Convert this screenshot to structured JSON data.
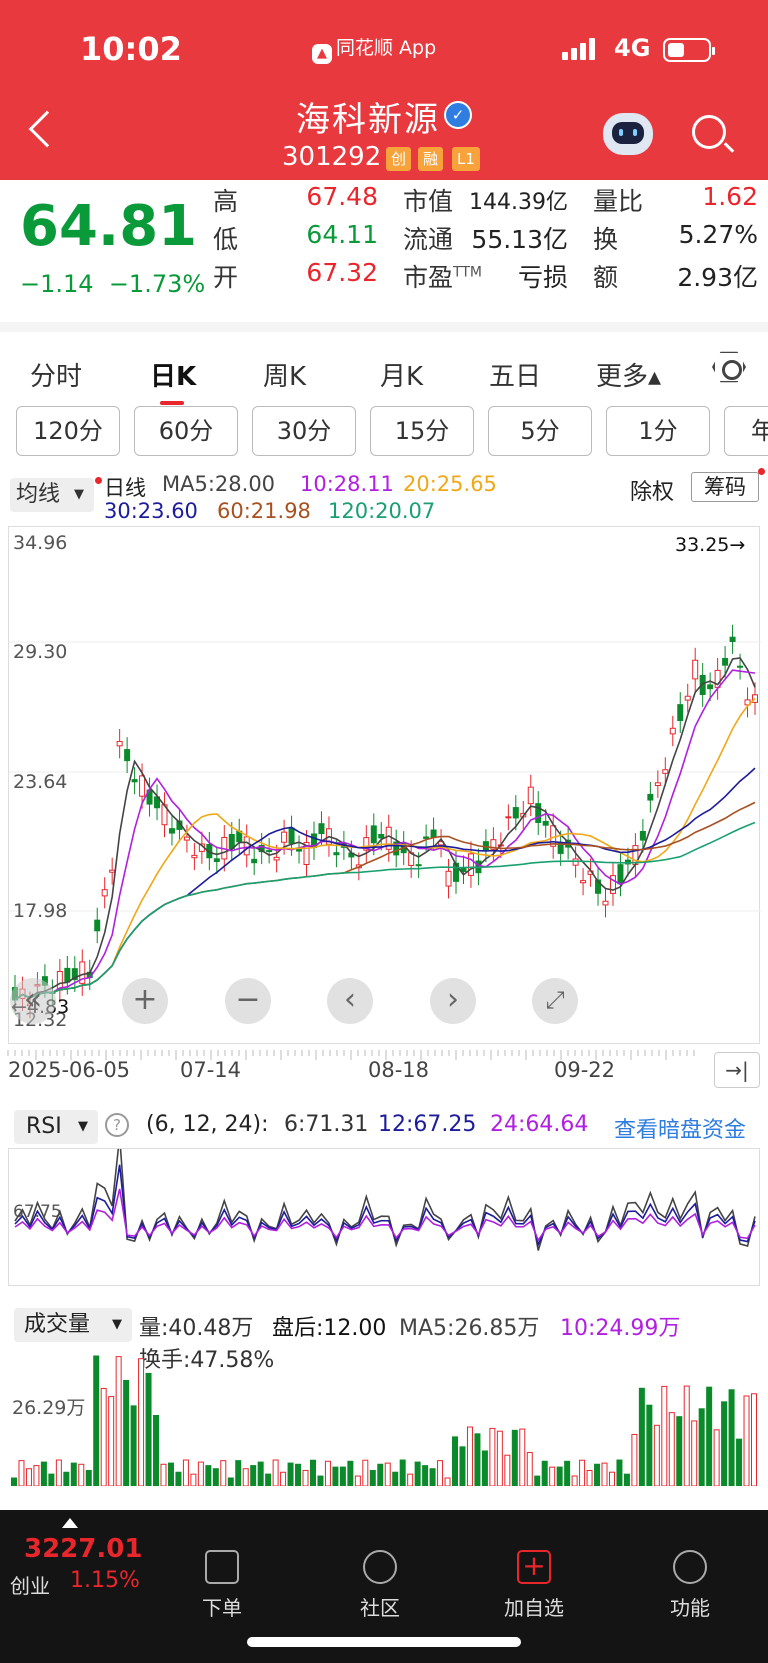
{
  "status_bar": {
    "time": "10:02",
    "app_name": "同花顺 App",
    "network": "4G"
  },
  "header": {
    "stock_name": "海科新源",
    "stock_code": "301292",
    "tags": [
      "创",
      "融",
      "L1"
    ]
  },
  "quote": {
    "price": "64.81",
    "change": "−1.14",
    "change_pct": "−1.73%",
    "labels": {
      "high": "高",
      "low": "低",
      "open": "开",
      "market_cap": "市值",
      "float": "流通",
      "pe": "市盈",
      "pe_sup": "TTM",
      "vol_ratio": "量比",
      "turnover": "换",
      "amount": "额"
    },
    "high": "67.48",
    "low": "64.11",
    "open": "67.32",
    "market_cap": "144.39亿",
    "float": "55.13亿",
    "pe": "亏损",
    "vol_ratio": "1.62",
    "turnover": "5.27%",
    "amount": "2.93亿"
  },
  "tabs": [
    {
      "label": "分时"
    },
    {
      "label": "日K",
      "active": true
    },
    {
      "label": "周K"
    },
    {
      "label": "月K"
    },
    {
      "label": "五日"
    },
    {
      "label": "更多▴"
    }
  ],
  "periods": [
    "120分",
    "60分",
    "30分",
    "15分",
    "5分",
    "1分",
    "年"
  ],
  "indicator_select": "均线",
  "ma": {
    "title": "日线",
    "ma5": "MA5:28.00",
    "ma10": "10:28.11",
    "ma20": "20:25.65",
    "ma30": "30:23.60",
    "ma60": "60:21.98",
    "ma120": "120:20.07",
    "chuquan": "除权",
    "chouma": "筹码"
  },
  "colors": {
    "ma5": "#444444",
    "ma10": "#b020e0",
    "ma20": "#f0a818",
    "ma30": "#1c1c9c",
    "ma60": "#a85020",
    "ma120": "#1aa070",
    "up": "#e8262c",
    "down": "#0a8a2a",
    "header_red": "#e8393f"
  },
  "kline": {
    "y_ticks": [
      "34.96",
      "29.30",
      "23.64",
      "17.98",
      "12.32"
    ],
    "max_marker": "33.25→",
    "min_marker": "←4.83",
    "x_dates": [
      "2025-06-05",
      "07-14",
      "08-18",
      "09-22"
    ]
  },
  "rsi": {
    "label": "RSI",
    "params": "(6, 12, 24):",
    "rsi6": "6:71.31",
    "rsi12": "12:67.25",
    "rsi24": "24:64.64",
    "link": "查看暗盘资金",
    "level": "67.75"
  },
  "volume": {
    "label": "成交量",
    "vol": "量:40.48万",
    "after": "盘后:12.00",
    "ma5": "MA5:26.85万",
    "ma10": "10:24.99万",
    "turnover": "换手:47.58%",
    "level": "26.29万"
  },
  "bottom_nav": {
    "index_value": "3227.01",
    "index_name": "创业",
    "index_pct": "1.15%",
    "items": [
      "下单",
      "社区",
      "加自选",
      "功能"
    ]
  }
}
